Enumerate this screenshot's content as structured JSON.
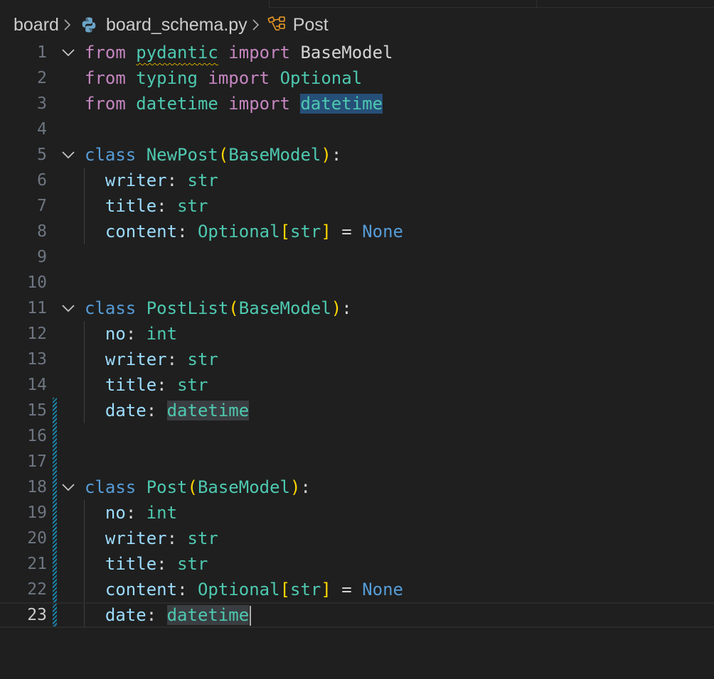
{
  "breadcrumb": {
    "folder": "board",
    "file": "board_schema.py",
    "symbol": "Post"
  },
  "colors": {
    "background": "#1f1f1f",
    "keyword_import": "#c586c0",
    "keyword_class": "#569cd6",
    "type": "#4ec9b0",
    "variable": "#9cdcfe",
    "bracket": "#ffd700",
    "selection": "#264f78"
  },
  "editor": {
    "current_line": 23,
    "lines": [
      {
        "n": "1",
        "tokens": [
          "from",
          "pydantic",
          "import",
          "BaseModel"
        ]
      },
      {
        "n": "2",
        "tokens": [
          "from",
          "typing",
          "import",
          "Optional"
        ]
      },
      {
        "n": "3",
        "tokens": [
          "from",
          "datetime",
          "import",
          "datetime"
        ]
      },
      {
        "n": "4",
        "tokens": []
      },
      {
        "n": "5",
        "tokens": [
          "class",
          "NewPost",
          "(",
          "BaseModel",
          ")",
          ":"
        ]
      },
      {
        "n": "6",
        "tokens": [
          "writer",
          ":",
          "str"
        ]
      },
      {
        "n": "7",
        "tokens": [
          "title",
          ":",
          "str"
        ]
      },
      {
        "n": "8",
        "tokens": [
          "content",
          ":",
          "Optional",
          "[",
          "str",
          "]",
          "=",
          "None"
        ]
      },
      {
        "n": "9",
        "tokens": []
      },
      {
        "n": "10",
        "tokens": []
      },
      {
        "n": "11",
        "tokens": [
          "class",
          "PostList",
          "(",
          "BaseModel",
          ")",
          ":"
        ]
      },
      {
        "n": "12",
        "tokens": [
          "no",
          ":",
          "int"
        ]
      },
      {
        "n": "13",
        "tokens": [
          "writer",
          ":",
          "str"
        ]
      },
      {
        "n": "14",
        "tokens": [
          "title",
          ":",
          "str"
        ]
      },
      {
        "n": "15",
        "tokens": [
          "date",
          ":",
          "datetime"
        ]
      },
      {
        "n": "16",
        "tokens": []
      },
      {
        "n": "17",
        "tokens": []
      },
      {
        "n": "18",
        "tokens": [
          "class",
          "Post",
          "(",
          "BaseModel",
          ")",
          ":"
        ]
      },
      {
        "n": "19",
        "tokens": [
          "no",
          ":",
          "int"
        ]
      },
      {
        "n": "20",
        "tokens": [
          "writer",
          ":",
          "str"
        ]
      },
      {
        "n": "21",
        "tokens": [
          "title",
          ":",
          "str"
        ]
      },
      {
        "n": "22",
        "tokens": [
          "content",
          ":",
          "Optional",
          "[",
          "str",
          "]",
          "=",
          "None"
        ]
      },
      {
        "n": "23",
        "tokens": [
          "date",
          ":",
          "datetime"
        ]
      }
    ]
  }
}
